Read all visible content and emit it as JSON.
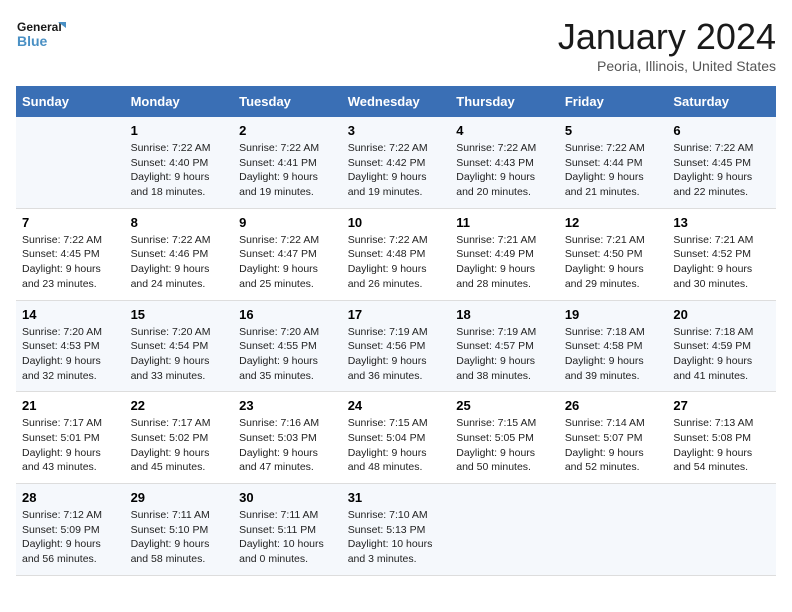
{
  "logo": {
    "line1": "General",
    "line2": "Blue"
  },
  "title": "January 2024",
  "subtitle": "Peoria, Illinois, United States",
  "days": [
    "Sunday",
    "Monday",
    "Tuesday",
    "Wednesday",
    "Thursday",
    "Friday",
    "Saturday"
  ],
  "weeks": [
    [
      {
        "date": "",
        "sunrise": "",
        "sunset": "",
        "daylight": ""
      },
      {
        "date": "1",
        "sunrise": "Sunrise: 7:22 AM",
        "sunset": "Sunset: 4:40 PM",
        "daylight": "Daylight: 9 hours and 18 minutes."
      },
      {
        "date": "2",
        "sunrise": "Sunrise: 7:22 AM",
        "sunset": "Sunset: 4:41 PM",
        "daylight": "Daylight: 9 hours and 19 minutes."
      },
      {
        "date": "3",
        "sunrise": "Sunrise: 7:22 AM",
        "sunset": "Sunset: 4:42 PM",
        "daylight": "Daylight: 9 hours and 19 minutes."
      },
      {
        "date": "4",
        "sunrise": "Sunrise: 7:22 AM",
        "sunset": "Sunset: 4:43 PM",
        "daylight": "Daylight: 9 hours and 20 minutes."
      },
      {
        "date": "5",
        "sunrise": "Sunrise: 7:22 AM",
        "sunset": "Sunset: 4:44 PM",
        "daylight": "Daylight: 9 hours and 21 minutes."
      },
      {
        "date": "6",
        "sunrise": "Sunrise: 7:22 AM",
        "sunset": "Sunset: 4:45 PM",
        "daylight": "Daylight: 9 hours and 22 minutes."
      }
    ],
    [
      {
        "date": "7",
        "sunrise": "Sunrise: 7:22 AM",
        "sunset": "Sunset: 4:45 PM",
        "daylight": "Daylight: 9 hours and 23 minutes."
      },
      {
        "date": "8",
        "sunrise": "Sunrise: 7:22 AM",
        "sunset": "Sunset: 4:46 PM",
        "daylight": "Daylight: 9 hours and 24 minutes."
      },
      {
        "date": "9",
        "sunrise": "Sunrise: 7:22 AM",
        "sunset": "Sunset: 4:47 PM",
        "daylight": "Daylight: 9 hours and 25 minutes."
      },
      {
        "date": "10",
        "sunrise": "Sunrise: 7:22 AM",
        "sunset": "Sunset: 4:48 PM",
        "daylight": "Daylight: 9 hours and 26 minutes."
      },
      {
        "date": "11",
        "sunrise": "Sunrise: 7:21 AM",
        "sunset": "Sunset: 4:49 PM",
        "daylight": "Daylight: 9 hours and 28 minutes."
      },
      {
        "date": "12",
        "sunrise": "Sunrise: 7:21 AM",
        "sunset": "Sunset: 4:50 PM",
        "daylight": "Daylight: 9 hours and 29 minutes."
      },
      {
        "date": "13",
        "sunrise": "Sunrise: 7:21 AM",
        "sunset": "Sunset: 4:52 PM",
        "daylight": "Daylight: 9 hours and 30 minutes."
      }
    ],
    [
      {
        "date": "14",
        "sunrise": "Sunrise: 7:20 AM",
        "sunset": "Sunset: 4:53 PM",
        "daylight": "Daylight: 9 hours and 32 minutes."
      },
      {
        "date": "15",
        "sunrise": "Sunrise: 7:20 AM",
        "sunset": "Sunset: 4:54 PM",
        "daylight": "Daylight: 9 hours and 33 minutes."
      },
      {
        "date": "16",
        "sunrise": "Sunrise: 7:20 AM",
        "sunset": "Sunset: 4:55 PM",
        "daylight": "Daylight: 9 hours and 35 minutes."
      },
      {
        "date": "17",
        "sunrise": "Sunrise: 7:19 AM",
        "sunset": "Sunset: 4:56 PM",
        "daylight": "Daylight: 9 hours and 36 minutes."
      },
      {
        "date": "18",
        "sunrise": "Sunrise: 7:19 AM",
        "sunset": "Sunset: 4:57 PM",
        "daylight": "Daylight: 9 hours and 38 minutes."
      },
      {
        "date": "19",
        "sunrise": "Sunrise: 7:18 AM",
        "sunset": "Sunset: 4:58 PM",
        "daylight": "Daylight: 9 hours and 39 minutes."
      },
      {
        "date": "20",
        "sunrise": "Sunrise: 7:18 AM",
        "sunset": "Sunset: 4:59 PM",
        "daylight": "Daylight: 9 hours and 41 minutes."
      }
    ],
    [
      {
        "date": "21",
        "sunrise": "Sunrise: 7:17 AM",
        "sunset": "Sunset: 5:01 PM",
        "daylight": "Daylight: 9 hours and 43 minutes."
      },
      {
        "date": "22",
        "sunrise": "Sunrise: 7:17 AM",
        "sunset": "Sunset: 5:02 PM",
        "daylight": "Daylight: 9 hours and 45 minutes."
      },
      {
        "date": "23",
        "sunrise": "Sunrise: 7:16 AM",
        "sunset": "Sunset: 5:03 PM",
        "daylight": "Daylight: 9 hours and 47 minutes."
      },
      {
        "date": "24",
        "sunrise": "Sunrise: 7:15 AM",
        "sunset": "Sunset: 5:04 PM",
        "daylight": "Daylight: 9 hours and 48 minutes."
      },
      {
        "date": "25",
        "sunrise": "Sunrise: 7:15 AM",
        "sunset": "Sunset: 5:05 PM",
        "daylight": "Daylight: 9 hours and 50 minutes."
      },
      {
        "date": "26",
        "sunrise": "Sunrise: 7:14 AM",
        "sunset": "Sunset: 5:07 PM",
        "daylight": "Daylight: 9 hours and 52 minutes."
      },
      {
        "date": "27",
        "sunrise": "Sunrise: 7:13 AM",
        "sunset": "Sunset: 5:08 PM",
        "daylight": "Daylight: 9 hours and 54 minutes."
      }
    ],
    [
      {
        "date": "28",
        "sunrise": "Sunrise: 7:12 AM",
        "sunset": "Sunset: 5:09 PM",
        "daylight": "Daylight: 9 hours and 56 minutes."
      },
      {
        "date": "29",
        "sunrise": "Sunrise: 7:11 AM",
        "sunset": "Sunset: 5:10 PM",
        "daylight": "Daylight: 9 hours and 58 minutes."
      },
      {
        "date": "30",
        "sunrise": "Sunrise: 7:11 AM",
        "sunset": "Sunset: 5:11 PM",
        "daylight": "Daylight: 10 hours and 0 minutes."
      },
      {
        "date": "31",
        "sunrise": "Sunrise: 7:10 AM",
        "sunset": "Sunset: 5:13 PM",
        "daylight": "Daylight: 10 hours and 3 minutes."
      },
      {
        "date": "",
        "sunrise": "",
        "sunset": "",
        "daylight": ""
      },
      {
        "date": "",
        "sunrise": "",
        "sunset": "",
        "daylight": ""
      },
      {
        "date": "",
        "sunrise": "",
        "sunset": "",
        "daylight": ""
      }
    ]
  ]
}
